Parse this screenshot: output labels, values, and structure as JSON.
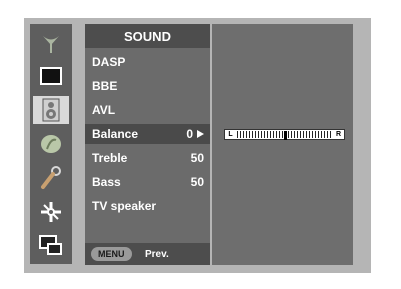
{
  "menu": {
    "title": "SOUND",
    "items": [
      {
        "label": "DASP",
        "value": "",
        "arrow": false,
        "selected": false
      },
      {
        "label": "BBE",
        "value": "",
        "arrow": false,
        "selected": false
      },
      {
        "label": "AVL",
        "value": "",
        "arrow": false,
        "selected": false
      },
      {
        "label": "Balance",
        "value": "0",
        "arrow": true,
        "selected": true
      },
      {
        "label": "Treble",
        "value": "50",
        "arrow": false,
        "selected": false
      },
      {
        "label": "Bass",
        "value": "50",
        "arrow": false,
        "selected": false
      },
      {
        "label": "TV speaker",
        "value": "",
        "arrow": false,
        "selected": false
      }
    ],
    "footer": {
      "button_label": "MENU",
      "prev_label": "Prev."
    }
  },
  "icons": [
    {
      "name": "antenna-icon",
      "active": false
    },
    {
      "name": "picture-icon",
      "active": false
    },
    {
      "name": "speaker-icon",
      "active": true
    },
    {
      "name": "clock-icon",
      "active": false
    },
    {
      "name": "wrench-icon",
      "active": false
    },
    {
      "name": "adjust-icon",
      "active": false
    },
    {
      "name": "pip-icon",
      "active": false
    }
  ],
  "balance_slider": {
    "left_label": "L",
    "right_label": "R",
    "value": 0,
    "min": -50,
    "max": 50
  },
  "colors": {
    "osd_frame": "#b5b5b5",
    "menu_panel": "#6b6b6b",
    "selected_row": "#4a4a4a",
    "active_icon_bg": "#d9d9d9"
  }
}
